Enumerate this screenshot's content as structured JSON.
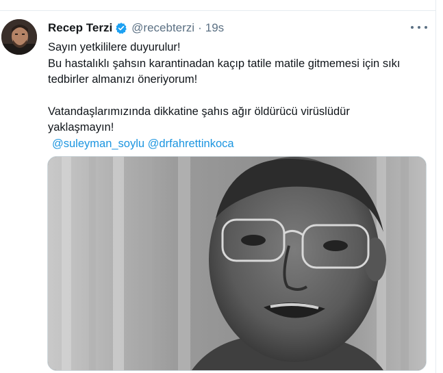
{
  "tweet": {
    "author_name": "Recep Terzi",
    "verified_icon": "verified-badge-icon",
    "handle": "@recebterzi",
    "separator": "·",
    "time": "19s",
    "more_icon": "more-options-icon",
    "lines": [
      "Sayın yetkililere duyurulur!",
      "Bu hastalıklı şahsın karantinadan kaçıp tatile matile gitmemesi için sıkı",
      "tedbirler almanızı öneriyorum!"
    ],
    "lines2": [
      "Vatandaşlarımızında dikkatine şahıs ağır öldürücü virüslüdür",
      "yaklaşmayın!"
    ],
    "mentions": [
      "@suleyman_soylu",
      "@drfahrettinkoca"
    ],
    "media_icon": "photo-of-man-with-glasses"
  },
  "colors": {
    "link": "#1b95e0",
    "verified": "#1da1f2",
    "secondary_text": "#5b7083",
    "border": "#e6ecf0"
  }
}
